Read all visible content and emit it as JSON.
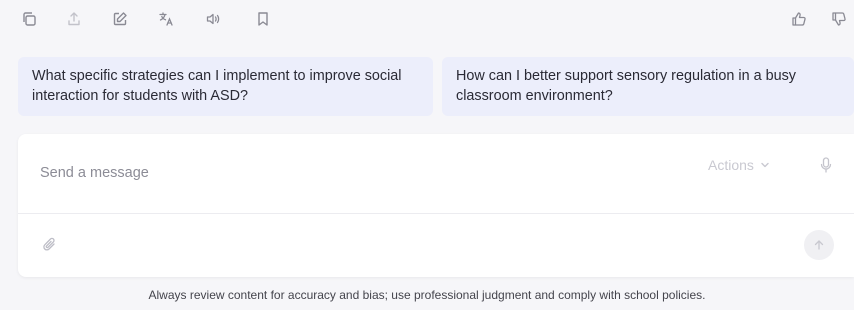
{
  "toolbar": {
    "left_icons": [
      "copy-icon",
      "share-icon",
      "edit-icon",
      "translate-icon",
      "speaker-icon",
      "bookmark-icon"
    ],
    "right_icons": [
      "thumbs-up-icon",
      "thumbs-down-icon"
    ]
  },
  "suggestions": [
    {
      "text": "What specific strategies can I implement to improve social interaction for students with ASD?"
    },
    {
      "text": "How can I better support sensory regulation in a busy classroom environment?"
    }
  ],
  "composer": {
    "placeholder": "Send a message",
    "actions_label": "Actions",
    "icons": [
      "chevron-down-icon",
      "microphone-icon",
      "paperclip-icon",
      "arrow-up-icon"
    ]
  },
  "disclaimer": "Always review content for accuracy and bias; use professional judgment and comply with school policies."
}
